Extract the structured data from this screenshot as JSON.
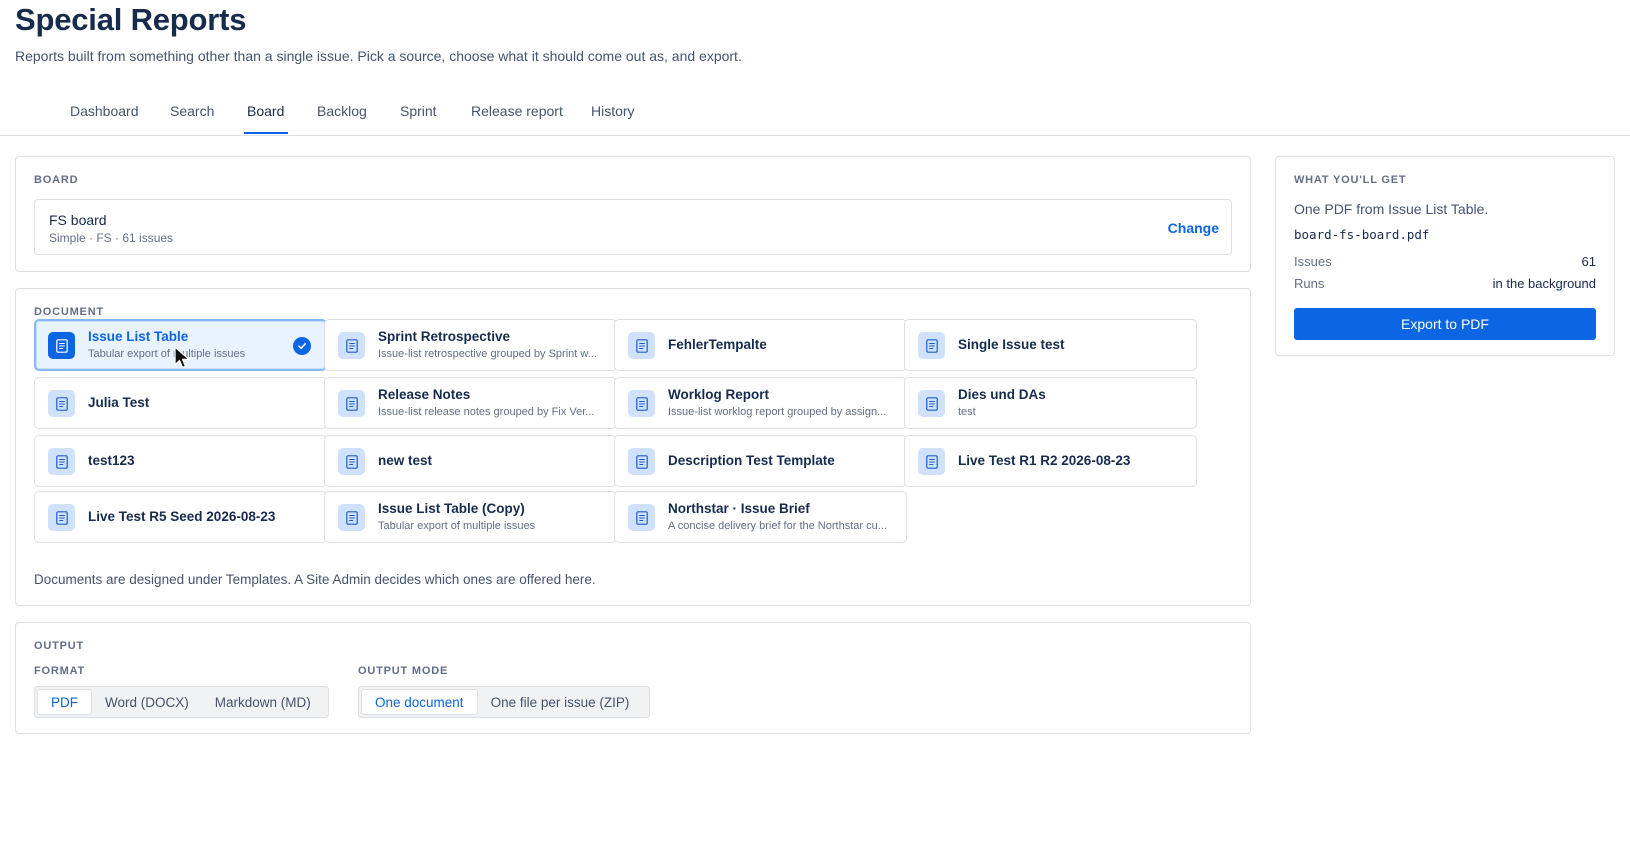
{
  "header": {
    "title": "Special Reports",
    "subtitle": "Reports built from something other than a single issue. Pick a source, choose what it should come out as, and export."
  },
  "tabs": [
    {
      "label": "Dashboard",
      "active": false
    },
    {
      "label": "Search",
      "active": false
    },
    {
      "label": "Board",
      "active": true
    },
    {
      "label": "Backlog",
      "active": false
    },
    {
      "label": "Sprint",
      "active": false
    },
    {
      "label": "Release report",
      "active": false
    },
    {
      "label": "History",
      "active": false
    }
  ],
  "board": {
    "section_label": "BOARD",
    "name": "FS board",
    "meta": "Simple · FS · 61 issues",
    "change_label": "Change"
  },
  "document": {
    "section_label": "DOCUMENT",
    "items": [
      {
        "title": "Issue List Table",
        "subtitle": "Tabular export of multiple issues",
        "selected": true
      },
      {
        "title": "Sprint Retrospective",
        "subtitle": "Issue-list retrospective grouped by Sprint w...",
        "selected": false
      },
      {
        "title": "FehlerTempalte",
        "subtitle": "",
        "selected": false
      },
      {
        "title": "Single Issue test",
        "subtitle": "",
        "selected": false
      },
      {
        "title": "Julia Test",
        "subtitle": "",
        "selected": false
      },
      {
        "title": "Release Notes",
        "subtitle": "Issue-list release notes grouped by Fix Ver...",
        "selected": false
      },
      {
        "title": "Worklog Report",
        "subtitle": "Issue-list worklog report grouped by assign...",
        "selected": false
      },
      {
        "title": "Dies und DAs",
        "subtitle": "test",
        "selected": false
      },
      {
        "title": "test123",
        "subtitle": "",
        "selected": false
      },
      {
        "title": "new test",
        "subtitle": "",
        "selected": false
      },
      {
        "title": "Description Test Template",
        "subtitle": "",
        "selected": false
      },
      {
        "title": "Live Test R1 R2 2026-08-23",
        "subtitle": "",
        "selected": false
      },
      {
        "title": "Live Test R5 Seed 2026-08-23",
        "subtitle": "",
        "selected": false
      },
      {
        "title": "Issue List Table (Copy)",
        "subtitle": "Tabular export of multiple issues",
        "selected": false
      },
      {
        "title": "Northstar · Issue Brief",
        "subtitle": "A concise delivery brief for the Northstar cu...",
        "selected": false
      }
    ],
    "footnote": "Documents are designed under Templates. A Site Admin decides which ones are offered here."
  },
  "output": {
    "section_label": "OUTPUT",
    "format_label": "FORMAT",
    "formats": [
      {
        "label": "PDF",
        "active": true
      },
      {
        "label": "Word (DOCX)",
        "active": false
      },
      {
        "label": "Markdown (MD)",
        "active": false
      }
    ],
    "mode_label": "OUTPUT MODE",
    "modes": [
      {
        "label": "One document",
        "active": true
      },
      {
        "label": "One file per issue (ZIP)",
        "active": false
      }
    ]
  },
  "summary": {
    "section_label": "WHAT YOU'LL GET",
    "description": "One PDF from Issue List Table.",
    "filename": "board-fs-board.pdf",
    "issues_label": "Issues",
    "issues_value": "61",
    "runs_label": "Runs",
    "runs_value": "in the background",
    "export_label": "Export to PDF"
  },
  "colors": {
    "accent": "#0c66e4",
    "selected_bg": "#e9f2ff",
    "icon_bg": "#cfe1fd"
  }
}
